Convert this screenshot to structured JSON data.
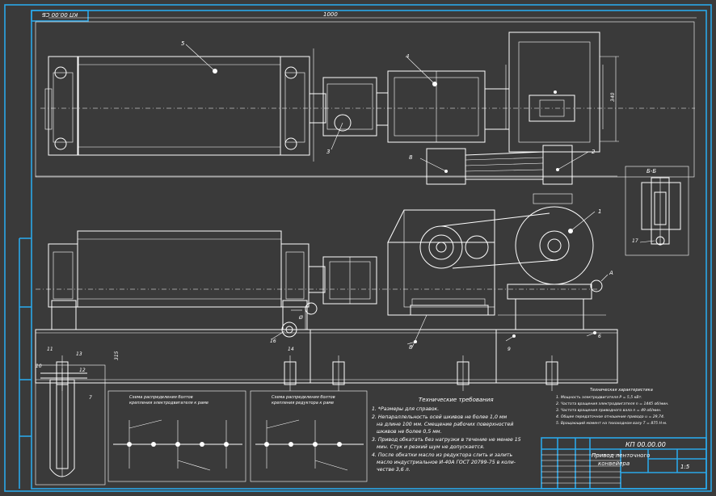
{
  "drawing": {
    "stamp_code": "КП 00.00 СБ",
    "drawing_number": "КП 00.00.00",
    "title_lines": [
      "Привод ленточного",
      "конвейера"
    ],
    "scale": "1:5",
    "tech_req_title": "Технические требования",
    "tech_req": [
      "1. *Размеры для справок.",
      "2. Непараллельность осей шкивов не более 1,0 мм",
      "на длине 100 мм. Смещение рабочих поверхностей",
      "шкивов не более 0,5 мм.",
      "3. Привод обкатать без нагрузки в течение не менее 15",
      "мин. Стук и резкий шум не допускается.",
      "4. После обкатки масло из редуктора слить и залить",
      "масло индустриальное И-40А ГОСТ 20799-75 в коли-",
      "честве 3,6 л."
    ],
    "tech_char_title": "Техническая характеристика",
    "tech_char": [
      "1. Мощность электродвигателя P = 5,5 кВт.",
      "2. Частота вращения электродвигателя n = 1445 об/мин.",
      "3. Частота вращения приводного вала n = 49 об/мин.",
      "4. Общее передаточное отношение привода u = 29,74.",
      "5. Вращающий момент на тихоходном валу T = 875 Н·м."
    ],
    "section_label": "Б-Б",
    "view_label": "А",
    "scheme1_title": [
      "Схема распределения болтов",
      "крепления электродвигателя к раме"
    ],
    "scheme2_title": [
      "Схема распределения болтов",
      "крепления редуктора к раме"
    ],
    "dim_top": "1000",
    "positions": [
      "1",
      "2",
      "3",
      "4",
      "5",
      "6",
      "7",
      "8",
      "9",
      "10",
      "11",
      "12",
      "13",
      "14",
      "15",
      "16",
      "17"
    ]
  }
}
